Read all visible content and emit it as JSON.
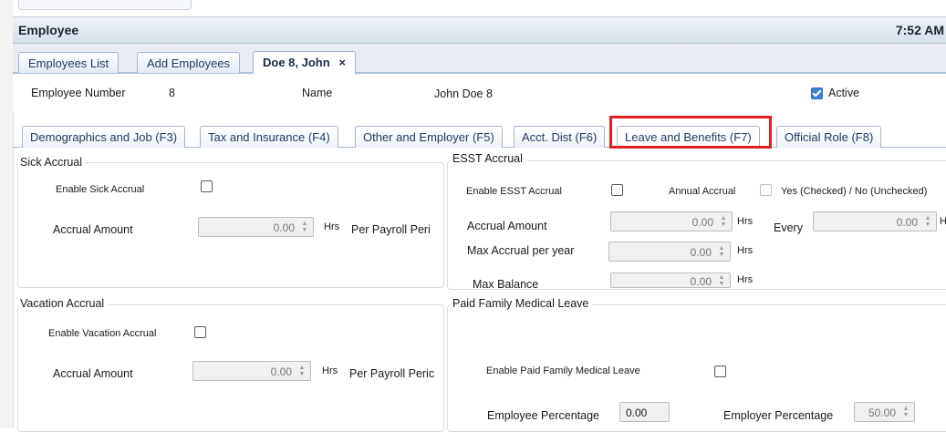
{
  "window": {
    "title": "Employee",
    "time": "7:52 AM"
  },
  "top_tabs": [
    {
      "label": "Employees List"
    },
    {
      "label": "Add Employees"
    },
    {
      "label": "Doe 8, John",
      "close": "×"
    }
  ],
  "info": {
    "employee_number_label": "Employee Number",
    "employee_number_value": "8",
    "name_label": "Name",
    "name_value": "John Doe 8",
    "active_label": "Active",
    "active_checked": true
  },
  "sub_tabs": [
    {
      "label": "Demographics and Job (F3)"
    },
    {
      "label": "Tax and Insurance (F4)"
    },
    {
      "label": "Other and Employer (F5)"
    },
    {
      "label": "Acct. Dist (F6)"
    },
    {
      "label": "Leave and Benefits (F7)"
    },
    {
      "label": "Official Role (F8)"
    }
  ],
  "sick": {
    "title": "Sick Accrual",
    "enable_label": "Enable Sick Accrual",
    "accrual_label": "Accrual Amount",
    "accrual_value": "0.00",
    "hrs": "Hrs",
    "per_label": "Per Payroll Peri"
  },
  "esst": {
    "title": "ESST Accrual",
    "enable_label": "Enable ESST Accrual",
    "annual_label": "Annual Accrual",
    "yes_no_label": "Yes (Checked) / No (Unchecked)",
    "accrual_label": "Accrual Amount",
    "accrual_value": "0.00",
    "hrs": "Hrs",
    "every_label": "Every",
    "every_value": "0.00",
    "every_unit": "H",
    "max_year_label": "Max Accrual per year",
    "max_year_value": "0.00",
    "max_balance_label": "Max Balance",
    "max_balance_value": "0.00"
  },
  "vacation": {
    "title": "Vacation Accrual",
    "enable_label": "Enable Vacation Accrual",
    "accrual_label": "Accrual Amount",
    "accrual_value": "0.00",
    "hrs": "Hrs",
    "per_label": "Per Payroll Peric"
  },
  "pfml": {
    "title": "Paid Family Medical Leave",
    "enable_label": "Enable Paid Family Medical Leave",
    "employee_pct_label": "Employee Percentage",
    "employee_pct_value": "0.00",
    "employer_pct_label": "Employer Percentage",
    "employer_pct_value": "50.00"
  },
  "colors": {
    "highlight": "#e0201f",
    "checkbox_checked": "#3f7fd6",
    "tab_text": "#1f3b63"
  }
}
